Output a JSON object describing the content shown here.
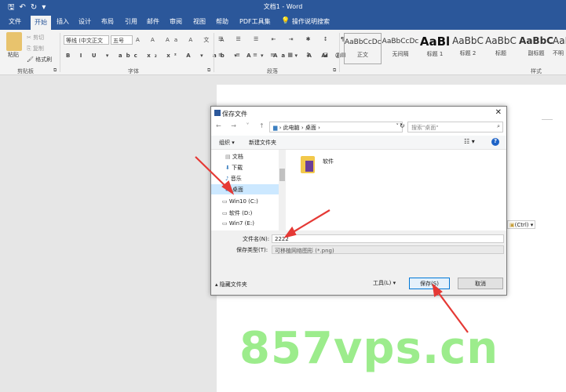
{
  "titlebar": {
    "title": "文档1 - Word",
    "qat_icons": [
      "save-icon",
      "undo-icon",
      "redo-icon",
      "dropdown-icon"
    ]
  },
  "tabs": [
    "文件",
    "开始",
    "插入",
    "设计",
    "布局",
    "引用",
    "邮件",
    "审阅",
    "视图",
    "帮助",
    "PDF工具集",
    "操作说明搜索"
  ],
  "active_tab": "开始",
  "ribbon": {
    "clipboard": {
      "paste": "粘贴",
      "cut": "剪切",
      "copy": "复制",
      "format_painter": "格式刷",
      "group": "剪贴板"
    },
    "font": {
      "font_name": "等线 (中文正文",
      "font_size": "五号",
      "group": "字体"
    },
    "paragraph": {
      "group": "段落"
    },
    "styles": {
      "items": [
        {
          "sample": "AaBbCcDc",
          "label": "正文"
        },
        {
          "sample": "AaBbCcDc",
          "label": "无间隔"
        },
        {
          "sample": "AaBl",
          "label": "标题 1"
        },
        {
          "sample": "AaBbC",
          "label": "标题 2"
        },
        {
          "sample": "AaBbC",
          "label": "标题"
        },
        {
          "sample": "AaBbC",
          "label": "副标题"
        },
        {
          "sample": "AaBbC",
          "label": "不明"
        }
      ],
      "group": "样式"
    }
  },
  "paste_options": "(Ctrl) ▾",
  "dialog": {
    "title": "保存文件",
    "close": "✕",
    "path": [
      "此电脑",
      "桌面"
    ],
    "search_placeholder": "搜索\"桌面\"",
    "organize": "组织 ▾",
    "new_folder": "新建文件夹",
    "nav_items": [
      "文档",
      "下载",
      "音乐",
      "桌面",
      "Win10 (C:)",
      "软件 (D:)",
      "Win7 (E:)"
    ],
    "files": [
      {
        "name": "软件"
      }
    ],
    "filename_label": "文件名(N):",
    "filename_value": "2222",
    "filetype_label": "保存类型(T):",
    "filetype_value": "可移植网络图形 (*.png)",
    "hide_folders": "隐藏文件夹",
    "tools": "工具(L)",
    "save": "保存(S)",
    "cancel": "取消"
  },
  "watermark": "857vps.cn",
  "colors": {
    "brand": "#2b579a",
    "annotation": "#e53935",
    "watermark": "#9cec8c"
  }
}
